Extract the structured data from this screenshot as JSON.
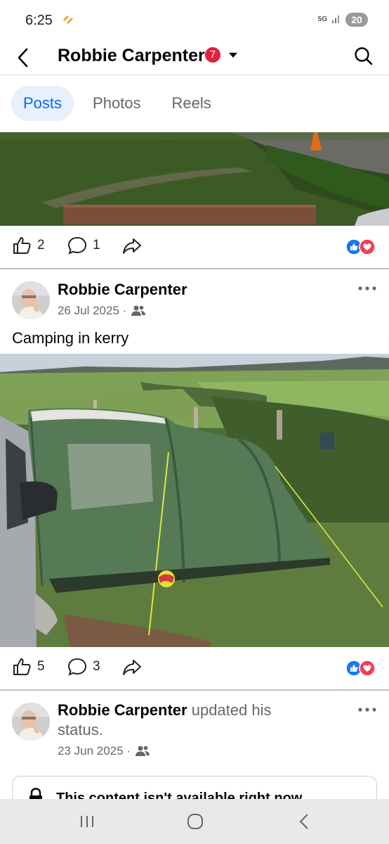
{
  "status_bar": {
    "time": "6:25",
    "network_label": "5G",
    "battery": "20"
  },
  "header": {
    "title": "Robbie Carpenter",
    "notification_count": "7"
  },
  "tabs": [
    {
      "label": "Posts",
      "active": true
    },
    {
      "label": "Photos",
      "active": false
    },
    {
      "label": "Reels",
      "active": false
    }
  ],
  "posts": [
    {
      "likes": "2",
      "comments": "1"
    },
    {
      "author": "Robbie Carpenter",
      "date": "26 Jul 2025 ·",
      "text": "Camping in kerry",
      "likes": "5",
      "comments": "3"
    },
    {
      "author": "Robbie Carpenter",
      "status_text": "updated his",
      "status_text_2": "status.",
      "date": "23 Jun 2025 ·",
      "unavailable_text": "This content isn't available right now"
    }
  ],
  "colors": {
    "accent": "#0866ff",
    "badge": "#e41e3f",
    "like": "#1877f2",
    "love": "#f33e58"
  }
}
